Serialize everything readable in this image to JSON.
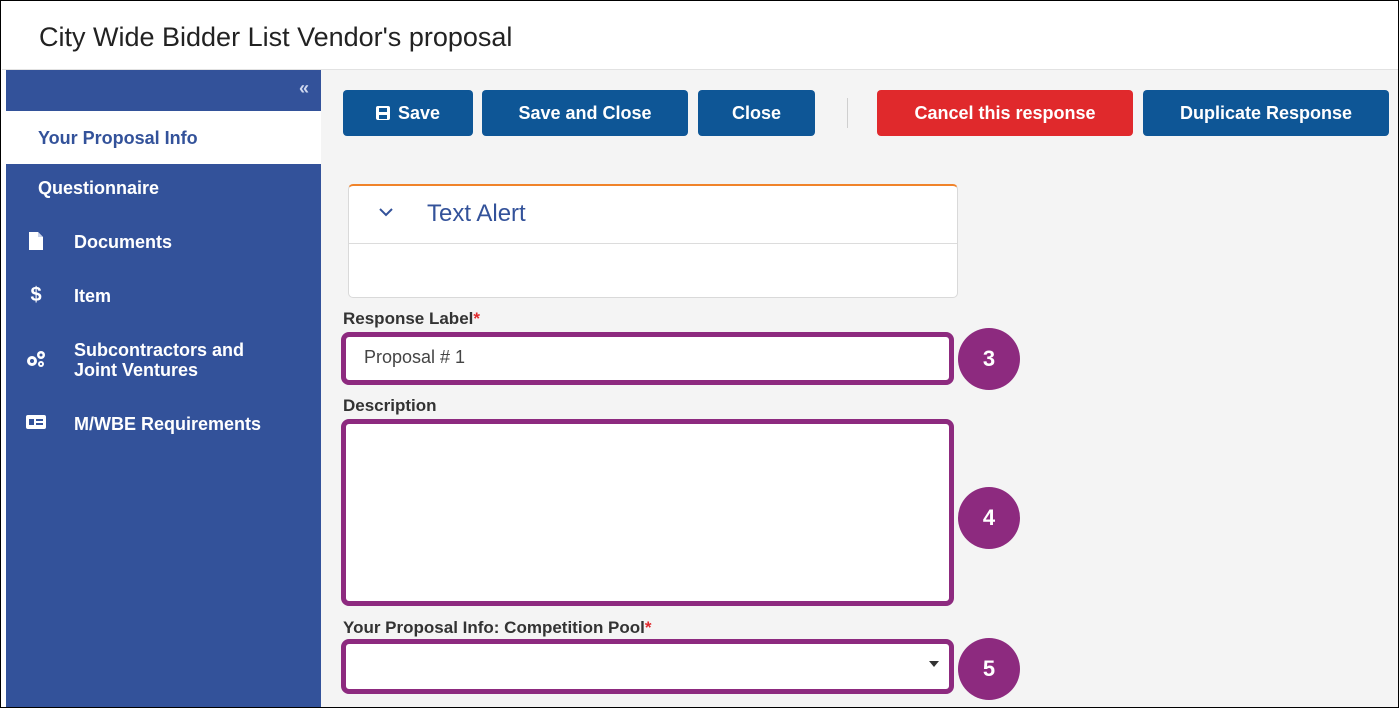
{
  "window": {
    "title": "City Wide Bidder List Vendor's proposal"
  },
  "sidebar": {
    "collapse_icon": "«",
    "items": [
      {
        "label": "Your Proposal Info",
        "icon": "",
        "active": true
      },
      {
        "label": "Questionnaire",
        "icon": ""
      },
      {
        "label": "Documents",
        "icon": "document-icon"
      },
      {
        "label": "Item",
        "icon": "dollar-icon"
      },
      {
        "label": "Subcontractors and",
        "label2": "Joint Ventures",
        "icon": "gears-icon"
      },
      {
        "label": "M/WBE Requirements",
        "icon": "id-card-icon"
      }
    ]
  },
  "toolbar": {
    "save_label": "Save",
    "save_close_label": "Save and Close",
    "close_label": "Close",
    "cancel_label": "Cancel this response",
    "duplicate_label": "Duplicate Response"
  },
  "alert": {
    "title": "Text Alert"
  },
  "form": {
    "response_label": {
      "label": "Response Label",
      "required_mark": "*",
      "value": "Proposal # 1"
    },
    "description": {
      "label": "Description",
      "value": ""
    },
    "competition_pool": {
      "label": "Your Proposal Info: Competition Pool",
      "required_mark": "*",
      "value": ""
    }
  },
  "annotations": {
    "badge_3": "3",
    "badge_4": "4",
    "badge_5": "5"
  },
  "colors": {
    "sidebar": "#33529a",
    "primary_button": "#0e5696",
    "danger_button": "#e0292c",
    "highlight": "#8d2a7f",
    "alert_accent": "#f0832a"
  }
}
